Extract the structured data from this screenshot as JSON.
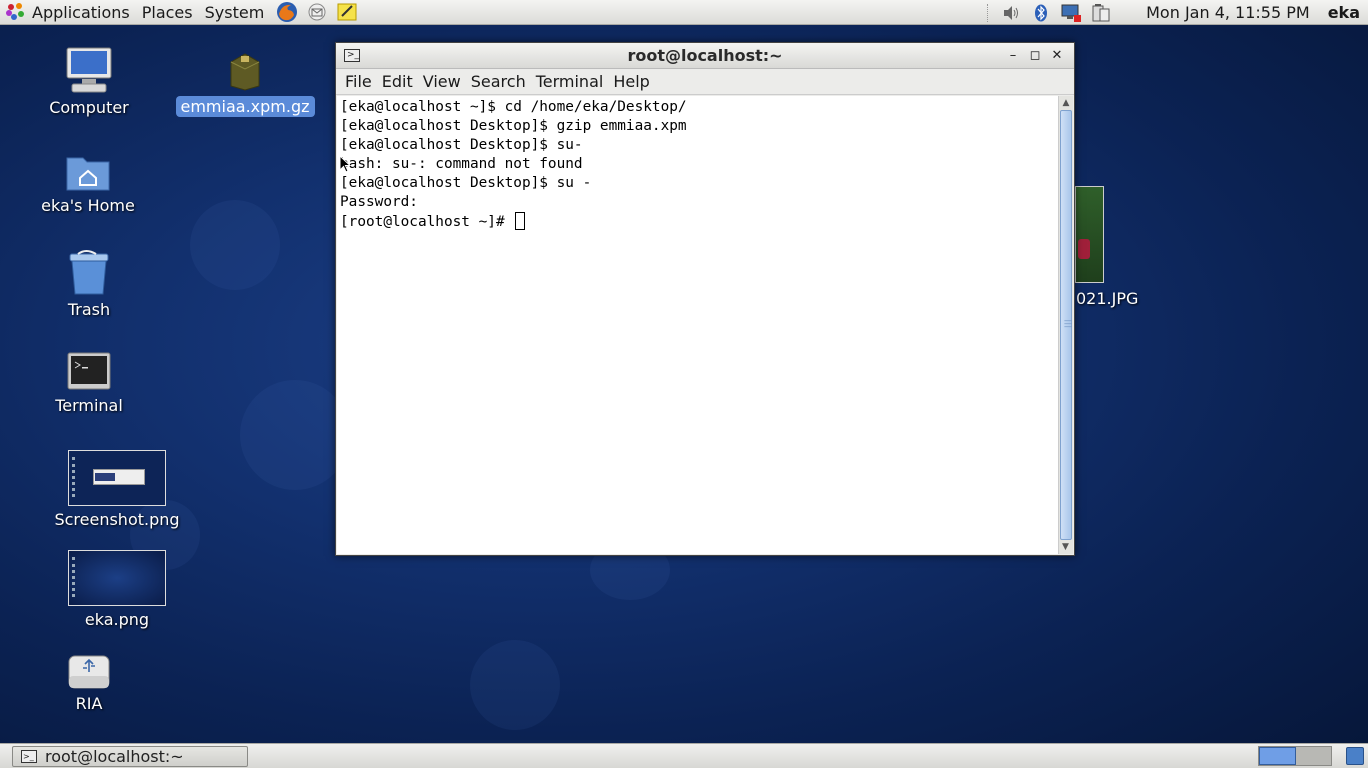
{
  "top_panel": {
    "menus": [
      "Applications",
      "Places",
      "System"
    ],
    "launchers": [
      "firefox-icon",
      "mail-icon",
      "notes-icon"
    ],
    "tray_icons": [
      "volume-icon",
      "bluetooth-icon",
      "network-icon",
      "battery-icon"
    ],
    "clock": "Mon Jan  4, 11:55 PM",
    "user": "eka"
  },
  "desktop": {
    "icons": [
      {
        "label": "Computer",
        "icon": "computer-icon"
      },
      {
        "label": "eka's Home",
        "icon": "home-folder-icon"
      },
      {
        "label": "Trash",
        "icon": "trash-icon"
      },
      {
        "label": "Terminal",
        "icon": "terminal-icon"
      },
      {
        "label": "Screenshot.png",
        "icon": "image-thumbnail"
      },
      {
        "label": "eka.png",
        "icon": "image-thumbnail"
      },
      {
        "label": "RIA",
        "icon": "usb-drive-icon"
      }
    ],
    "selected_file": "emmiaa.xpm.gz",
    "partial_file": "021.JPG"
  },
  "terminal": {
    "title": "root@localhost:~",
    "menu": [
      "File",
      "Edit",
      "View",
      "Search",
      "Terminal",
      "Help"
    ],
    "lines": [
      "[eka@localhost ~]$ cd /home/eka/Desktop/",
      "[eka@localhost Desktop]$ gzip emmiaa.xpm",
      "[eka@localhost Desktop]$ su-",
      "bash: su-: command not found",
      "[eka@localhost Desktop]$ su -",
      "Password:"
    ],
    "prompt": "[root@localhost ~]# "
  },
  "bottom_panel": {
    "task": "root@localhost:~"
  },
  "colors": {
    "desktop_bg": "#12306e",
    "selection": "#5b8bd9",
    "terminal_bg": "#ffffff"
  }
}
